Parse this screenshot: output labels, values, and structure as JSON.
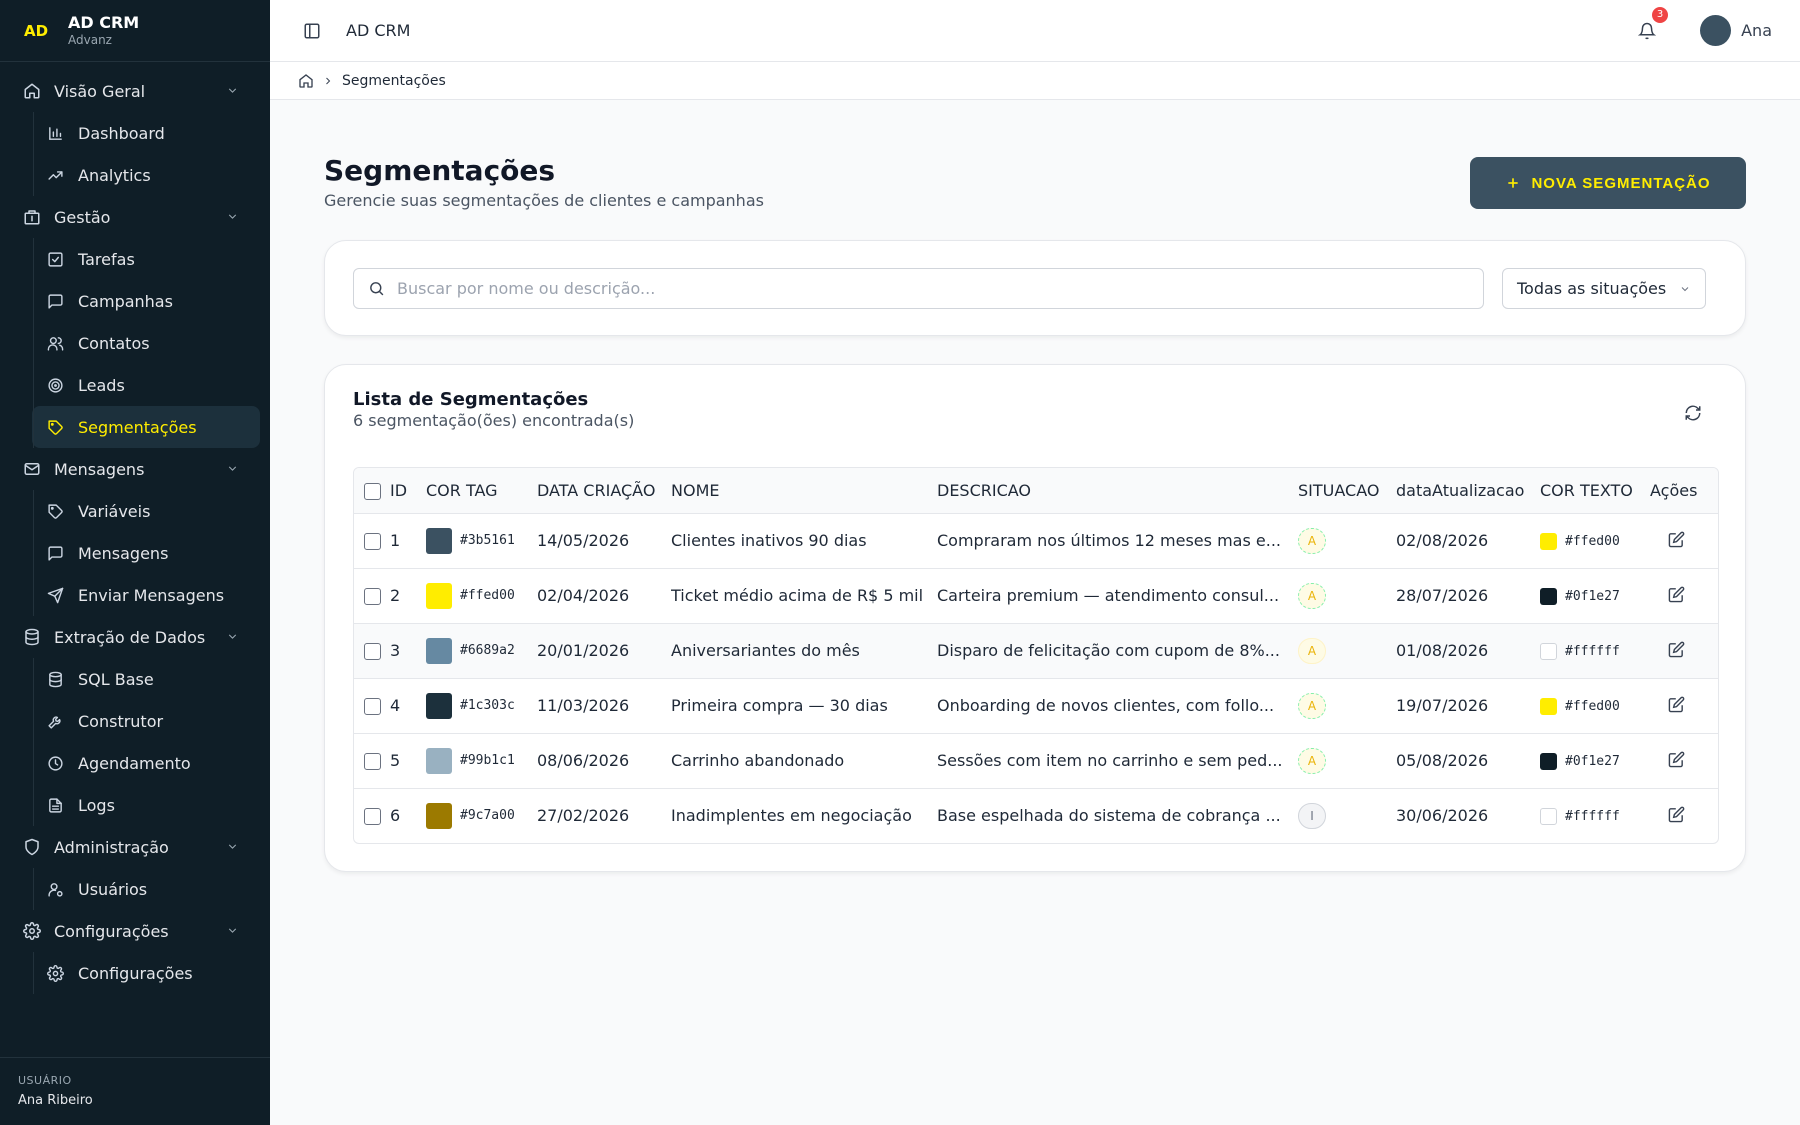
{
  "brand": {
    "logo": "AD",
    "name": "AD CRM",
    "sub": "Advanz"
  },
  "sidebar": {
    "groups": [
      {
        "label": "Visão Geral",
        "icon": "home-icon",
        "items": [
          {
            "label": "Dashboard",
            "icon": "bar-chart-icon"
          },
          {
            "label": "Analytics",
            "icon": "trending-up-icon"
          }
        ]
      },
      {
        "label": "Gestão",
        "icon": "building-icon",
        "items": [
          {
            "label": "Tarefas",
            "icon": "check-square-icon"
          },
          {
            "label": "Campanhas",
            "icon": "message-square-icon"
          },
          {
            "label": "Contatos",
            "icon": "users-icon"
          },
          {
            "label": "Leads",
            "icon": "target-icon"
          },
          {
            "label": "Segmentações",
            "icon": "tag-icon",
            "active": true
          }
        ]
      },
      {
        "label": "Mensagens",
        "icon": "mail-icon",
        "items": [
          {
            "label": "Variáveis",
            "icon": "tag-icon"
          },
          {
            "label": "Mensagens",
            "icon": "message-square-icon"
          },
          {
            "label": "Enviar Mensagens",
            "icon": "send-icon"
          }
        ]
      },
      {
        "label": "Extração de Dados",
        "icon": "database-icon",
        "items": [
          {
            "label": "SQL Base",
            "icon": "database-icon"
          },
          {
            "label": "Construtor",
            "icon": "wrench-icon"
          },
          {
            "label": "Agendamento",
            "icon": "clock-icon"
          },
          {
            "label": "Logs",
            "icon": "file-text-icon"
          }
        ]
      },
      {
        "label": "Administração",
        "icon": "shield-icon",
        "items": [
          {
            "label": "Usuários",
            "icon": "user-cog-icon"
          }
        ]
      },
      {
        "label": "Configurações",
        "icon": "gear-icon",
        "items": [
          {
            "label": "Configurações",
            "icon": "gear-icon"
          }
        ]
      }
    ],
    "user_caption": "USUÁRIO",
    "user_name": "Ana Ribeiro"
  },
  "topbar": {
    "title": "AD CRM",
    "notifications": "3",
    "user": "Ana"
  },
  "breadcrumb": {
    "current": "Segmentações"
  },
  "page": {
    "title": "Segmentações",
    "subtitle": "Gerencie suas segmentações de clientes e campanhas",
    "new_button": "NOVA SEGMENTAÇÃO",
    "search_placeholder": "Buscar por nome ou descrição...",
    "status_filter": "Todas as situações"
  },
  "list": {
    "title": "Lista de Segmentações",
    "count": "6 segmentação(ões) encontrada(s)",
    "columns": [
      "ID",
      "COR TAG",
      "DATA CRIAÇÃO",
      "NOME",
      "DESCRICAO",
      "SITUACAO",
      "dataAtualizacao",
      "COR TEXTO",
      "Ações"
    ],
    "rows": [
      {
        "id": "1",
        "tag_color": "#3b5161",
        "created": "14/05/2026",
        "name": "Clientes inativos 90 dias",
        "description": "Compraram nos últimos 12 meses mas e...",
        "status": "A",
        "updated": "02/08/2026",
        "text_color": "#ffed00"
      },
      {
        "id": "2",
        "tag_color": "#ffed00",
        "created": "02/04/2026",
        "name": "Ticket médio acima de R$ 5 mil",
        "description": "Carteira premium — atendimento consul...",
        "status": "A",
        "updated": "28/07/2026",
        "text_color": "#0f1e27"
      },
      {
        "id": "3",
        "tag_color": "#6689a2",
        "created": "20/01/2026",
        "name": "Aniversariantes do mês",
        "description": "Disparo de felicitação com cupom de 8%...",
        "status": "A",
        "updated": "01/08/2026",
        "text_color": "#ffffff"
      },
      {
        "id": "4",
        "tag_color": "#1c303c",
        "created": "11/03/2026",
        "name": "Primeira compra — 30 dias",
        "description": "Onboarding de novos clientes, com follo...",
        "status": "A",
        "updated": "19/07/2026",
        "text_color": "#ffed00"
      },
      {
        "id": "5",
        "tag_color": "#99b1c1",
        "created": "08/06/2026",
        "name": "Carrinho abandonado",
        "description": "Sessões com item no carrinho e sem ped...",
        "status": "A",
        "updated": "05/08/2026",
        "text_color": "#0f1e27"
      },
      {
        "id": "6",
        "tag_color": "#9c7a00",
        "created": "27/02/2026",
        "name": "Inadimplentes em negociação",
        "description": "Base espelhada do sistema de cobrança ...",
        "status": "I",
        "updated": "30/06/2026",
        "text_color": "#ffffff"
      }
    ]
  }
}
